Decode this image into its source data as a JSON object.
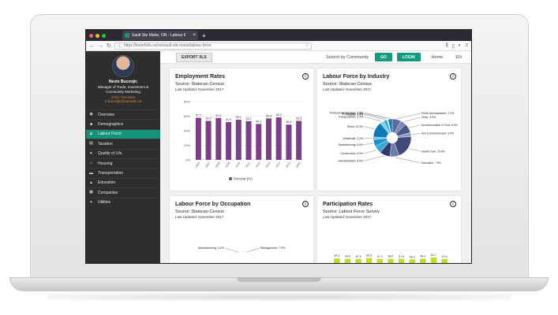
{
  "browser": {
    "tab_title": "Sault Ste Marie, ON - Labour F",
    "url": "https://townfolio.co/on/sault-ste-marie/labour-force"
  },
  "sidebar": {
    "name": "Nevin Buconjic",
    "title": "Manager of Trade, Investment & Community Marketing",
    "phone": "(705) 759-5928",
    "email": "n.buconjic@ssmedc.ca",
    "items": [
      {
        "label": "Overview",
        "icon": "eye-icon"
      },
      {
        "label": "Demographics",
        "icon": "people-icon"
      },
      {
        "label": "Labour Force",
        "icon": "person-icon"
      },
      {
        "label": "Taxation",
        "icon": "document-icon"
      },
      {
        "label": "Quality of Life",
        "icon": "heart-icon"
      },
      {
        "label": "Housing",
        "icon": "house-icon"
      },
      {
        "label": "Transportation",
        "icon": "truck-icon"
      },
      {
        "label": "Education",
        "icon": "graduation-icon"
      },
      {
        "label": "Companies",
        "icon": "building-icon"
      },
      {
        "label": "Utilities",
        "icon": "bulb-icon"
      }
    ],
    "active_index": 2,
    "active_color": "#12937a"
  },
  "topbar": {
    "export_label": "EXPORT XLS",
    "search_label": "Search by Community",
    "go_label": "GO",
    "login_label": "LOGIN",
    "home_label": "Home",
    "lang_label": "EN"
  },
  "cards": {
    "employment": {
      "title": "Employment Rates",
      "source": "Source: Statscan Census",
      "updated": "Last Updated: November 2017"
    },
    "industry": {
      "title": "Labour Force by Industry",
      "source": "Source: Statscan Census",
      "updated": "Last Updated: November 2017"
    },
    "occupation": {
      "title": "Labour Force by Occupation",
      "source": "Source: Statscan Census",
      "updated": "Last Updated: November 2017"
    },
    "participation": {
      "title": "Participation Rates",
      "source": "Source: Labour Force Survey",
      "updated": "Last Updated: November 2017"
    }
  },
  "chart_data": [
    {
      "type": "bar",
      "categories": [
        "2006",
        "2007",
        "2008",
        "2009",
        "2010",
        "2011",
        "2012",
        "2013",
        "2014",
        "2015",
        "2016"
      ],
      "series": [
        {
          "name": "Percent (%)",
          "values": [
            57.7,
            53.5,
            57.5,
            51.9,
            55.1,
            53.2,
            49.3,
            56.8,
            58.3,
            48.4,
            53.5
          ]
        }
      ],
      "ylim": [
        0,
        80
      ],
      "yticks": [
        "0%",
        "20%",
        "40%",
        "60%",
        "80%"
      ],
      "color": "#7b3f86"
    },
    {
      "type": "pie",
      "categories": [
        "Public Administration",
        "Other",
        "Accommodation & Food",
        "Arts & Entertainment",
        "Health Care",
        "Education",
        "Administration",
        "Construction",
        "Manufacturing",
        "Wholesale",
        "Retail",
        "Transportation",
        "Finance",
        "Real Estate",
        "Professional Services"
      ],
      "values": [
        7.3,
        4.9,
        8.0,
        3.5,
        19.8,
        7.9,
        8.6,
        6.9,
        5.6,
        2.2,
        13.3,
        3.4,
        2.5,
        1.3,
        3.5
      ],
      "labels": [
        "Public Administration: 7.3%",
        "Other: 4.9%",
        "Accommodation & Food: 8.0%",
        "Arts & Entertainment: 3.5%",
        "Health Care: 19.8%",
        "Education: 7.9%",
        "Administration: 8.6%",
        "Construction: 6.9%",
        "Manufacturing: 5.6%",
        "Wholesale: 2.2%",
        "Retail: 13.3%",
        "Transportation: 3.4%",
        "Finance: 2.5%",
        "Real Estate: 1.3%",
        "Professional Services: 3.5%"
      ]
    },
    {
      "type": "pie",
      "labels": [
        "Manufacturing: 4.2%",
        "Management: 7.9%"
      ],
      "values": [
        4.2,
        7.9
      ]
    },
    {
      "type": "bar",
      "values": [
        59.4,
        58.4,
        57.6,
        60.8,
        57.2,
        58.0,
        57.8,
        56.3,
        58.3,
        62.7,
        57.6
      ],
      "color": "#c4d92e"
    }
  ]
}
